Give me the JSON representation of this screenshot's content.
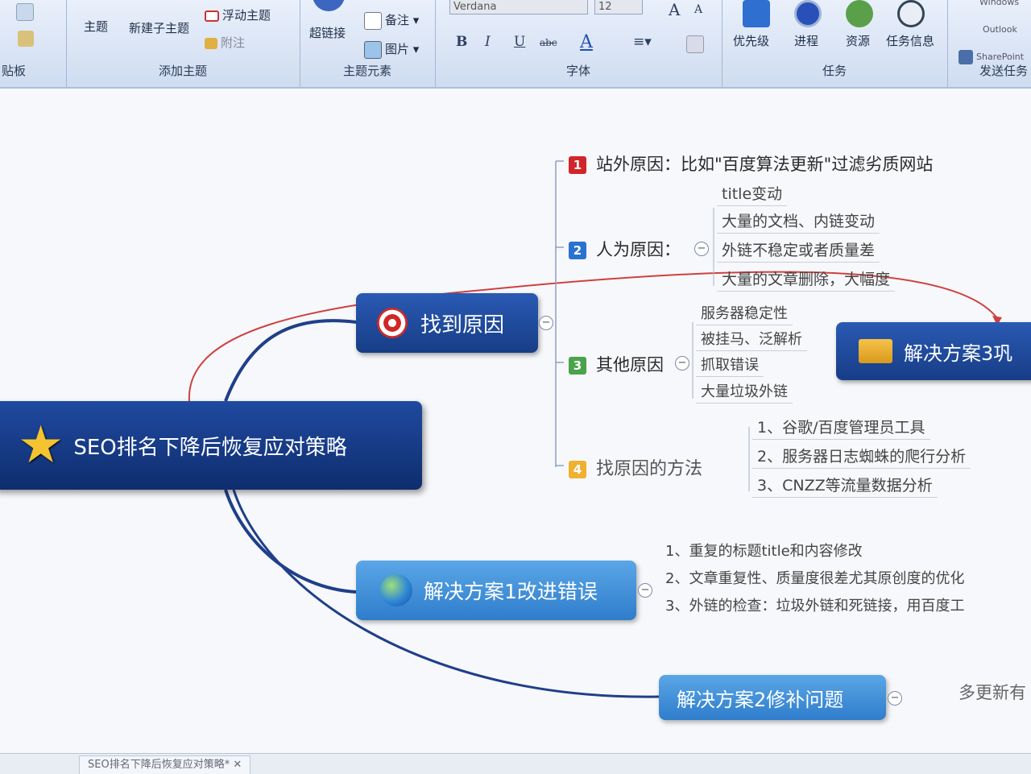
{
  "ribbon": {
    "clipboard_label": "贴板",
    "add_topic": {
      "topic": "主题",
      "subtopic": "新建子主题",
      "floating": "浮动主题",
      "callout": "附注",
      "group_label": "添加主题"
    },
    "topic_elements": {
      "hyperlink": "超链接",
      "notes": "备注",
      "picture": "图片",
      "group_label": "主题元素"
    },
    "font": {
      "name": "Verdana",
      "size": "12",
      "group_label": "字体",
      "bold": "B",
      "italic": "I",
      "underline": "U",
      "strike": "abc",
      "color": "A"
    },
    "task": {
      "priority": "优先级",
      "progress": "进程",
      "resource": "资源",
      "task_info": "任务信息",
      "group_label": "任务"
    },
    "send": {
      "windows": "Windows",
      "outlook": "Outlook",
      "sharepoint": "SharePoint",
      "group_label": "发送任务"
    }
  },
  "map": {
    "central": "SEO排名下降后恢复应对策略",
    "find_cause": {
      "title": "找到原因",
      "items": [
        {
          "num": "1",
          "text": "站外原因：比如\"百度算法更新\"过滤劣质网站"
        },
        {
          "num": "2",
          "text": "人为原因：",
          "leaves": [
            "title变动",
            "大量的文档、内链变动",
            "外链不稳定或者质量差",
            "大量的文章删除，大幅度"
          ]
        },
        {
          "num": "3",
          "text": "其他原因",
          "leaves": [
            "服务器稳定性",
            "被挂马、泛解析",
            "抓取错误",
            "大量垃圾外链"
          ]
        },
        {
          "num": "4",
          "text": "找原因的方法",
          "leaves": [
            "1、谷歌/百度管理员工具",
            "2、服务器日志蜘蛛的爬行分析",
            "3、CNZZ等流量数据分析"
          ]
        }
      ]
    },
    "solution1": {
      "title": "解决方案1改进错误",
      "leaves": [
        "1、重复的标题title和内容修改",
        "2、文章重复性、质量度很差尤其原创度的优化",
        "3、外链的检查：垃圾外链和死链接，用百度工"
      ]
    },
    "solution2": {
      "title": "解决方案2修补问题",
      "leaves": [
        "多更新有"
      ]
    },
    "solution3": {
      "title": "解决方案3巩"
    }
  },
  "statusbar": {
    "tab": "SEO排名下降后恢复应对策略*"
  },
  "colors": {
    "num1": "#d0262a",
    "num2": "#2a72d0",
    "num3": "#4aa34a",
    "num4": "#f0b030",
    "relation": "#d04040",
    "branch": "#1f3f8a"
  }
}
